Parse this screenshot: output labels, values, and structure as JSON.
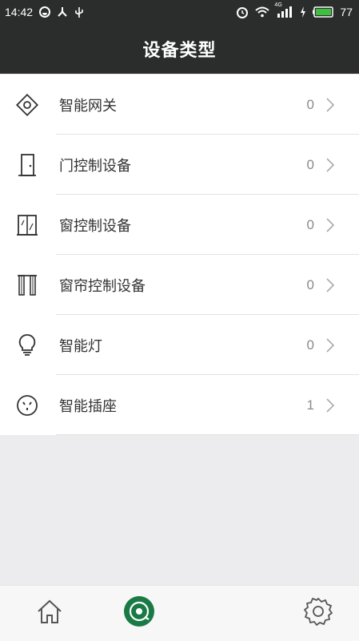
{
  "status_bar": {
    "time": "14:42",
    "network_label": "4G",
    "battery": "77"
  },
  "header": {
    "title": "设备类型"
  },
  "devices": [
    {
      "label": "智能网关",
      "count": "0",
      "icon": "gateway-icon"
    },
    {
      "label": "门控制设备",
      "count": "0",
      "icon": "door-icon"
    },
    {
      "label": "窗控制设备",
      "count": "0",
      "icon": "window-icon"
    },
    {
      "label": "窗帘控制设备",
      "count": "0",
      "icon": "curtain-icon"
    },
    {
      "label": "智能灯",
      "count": "0",
      "icon": "bulb-icon"
    },
    {
      "label": "智能插座",
      "count": "1",
      "icon": "socket-icon"
    }
  ],
  "bottom_nav": {
    "items": [
      "home-icon",
      "device-radar-icon",
      "settings-icon"
    ],
    "active_color": "#1a7a46"
  },
  "colors": {
    "header_bg": "#2b2d2c",
    "list_bg": "#ffffff",
    "page_bg": "#ececee",
    "battery_green": "#3fbf3f"
  }
}
